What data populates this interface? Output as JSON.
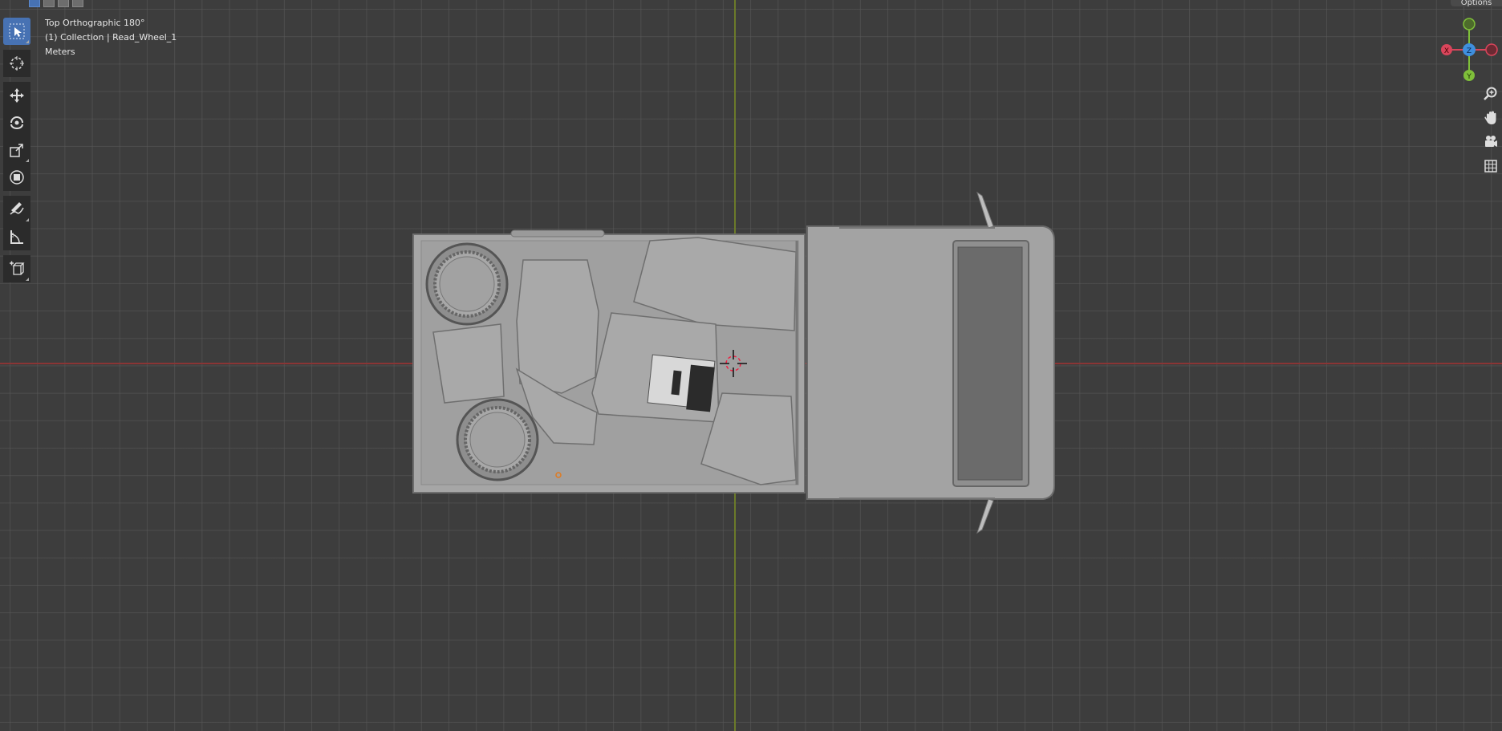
{
  "viewport": {
    "view_name": "Top Orthographic 180°",
    "collection_line": "(1) Collection | Read_Wheel_1",
    "units": "Meters"
  },
  "header": {
    "options_label": "Options"
  },
  "toolbar": {
    "tools": [
      {
        "name": "select-box",
        "icon": "cursor-select-icon",
        "active": true
      },
      {
        "name": "cursor",
        "icon": "3d-cursor-icon",
        "active": false
      },
      {
        "name": "move",
        "icon": "move-arrows-icon",
        "active": false
      },
      {
        "name": "rotate",
        "icon": "rotate-icon",
        "active": false
      },
      {
        "name": "scale",
        "icon": "scale-icon",
        "active": false
      },
      {
        "name": "transform",
        "icon": "transform-icon",
        "active": false
      },
      {
        "name": "annotate",
        "icon": "pencil-annotate-icon",
        "active": false
      },
      {
        "name": "measure",
        "icon": "ruler-measure-icon",
        "active": false
      },
      {
        "name": "add-cube",
        "icon": "add-cube-icon",
        "active": false
      }
    ]
  },
  "gizmo": {
    "x_label": "X",
    "y_label": "Y",
    "z_label": "Z",
    "colors": {
      "x": "#d9455b",
      "y": "#7fbf3a",
      "z": "#3f8fde"
    }
  },
  "nav_controls": [
    "zoom-icon",
    "pan-hand-icon",
    "camera-icon",
    "grid-perspective-icon"
  ],
  "colors": {
    "background": "#3d3d3d",
    "x_axis": "#8a3535",
    "y_axis": "#6b7a2a",
    "active_tool": "#4772b3",
    "model": "#9c9c9c"
  }
}
